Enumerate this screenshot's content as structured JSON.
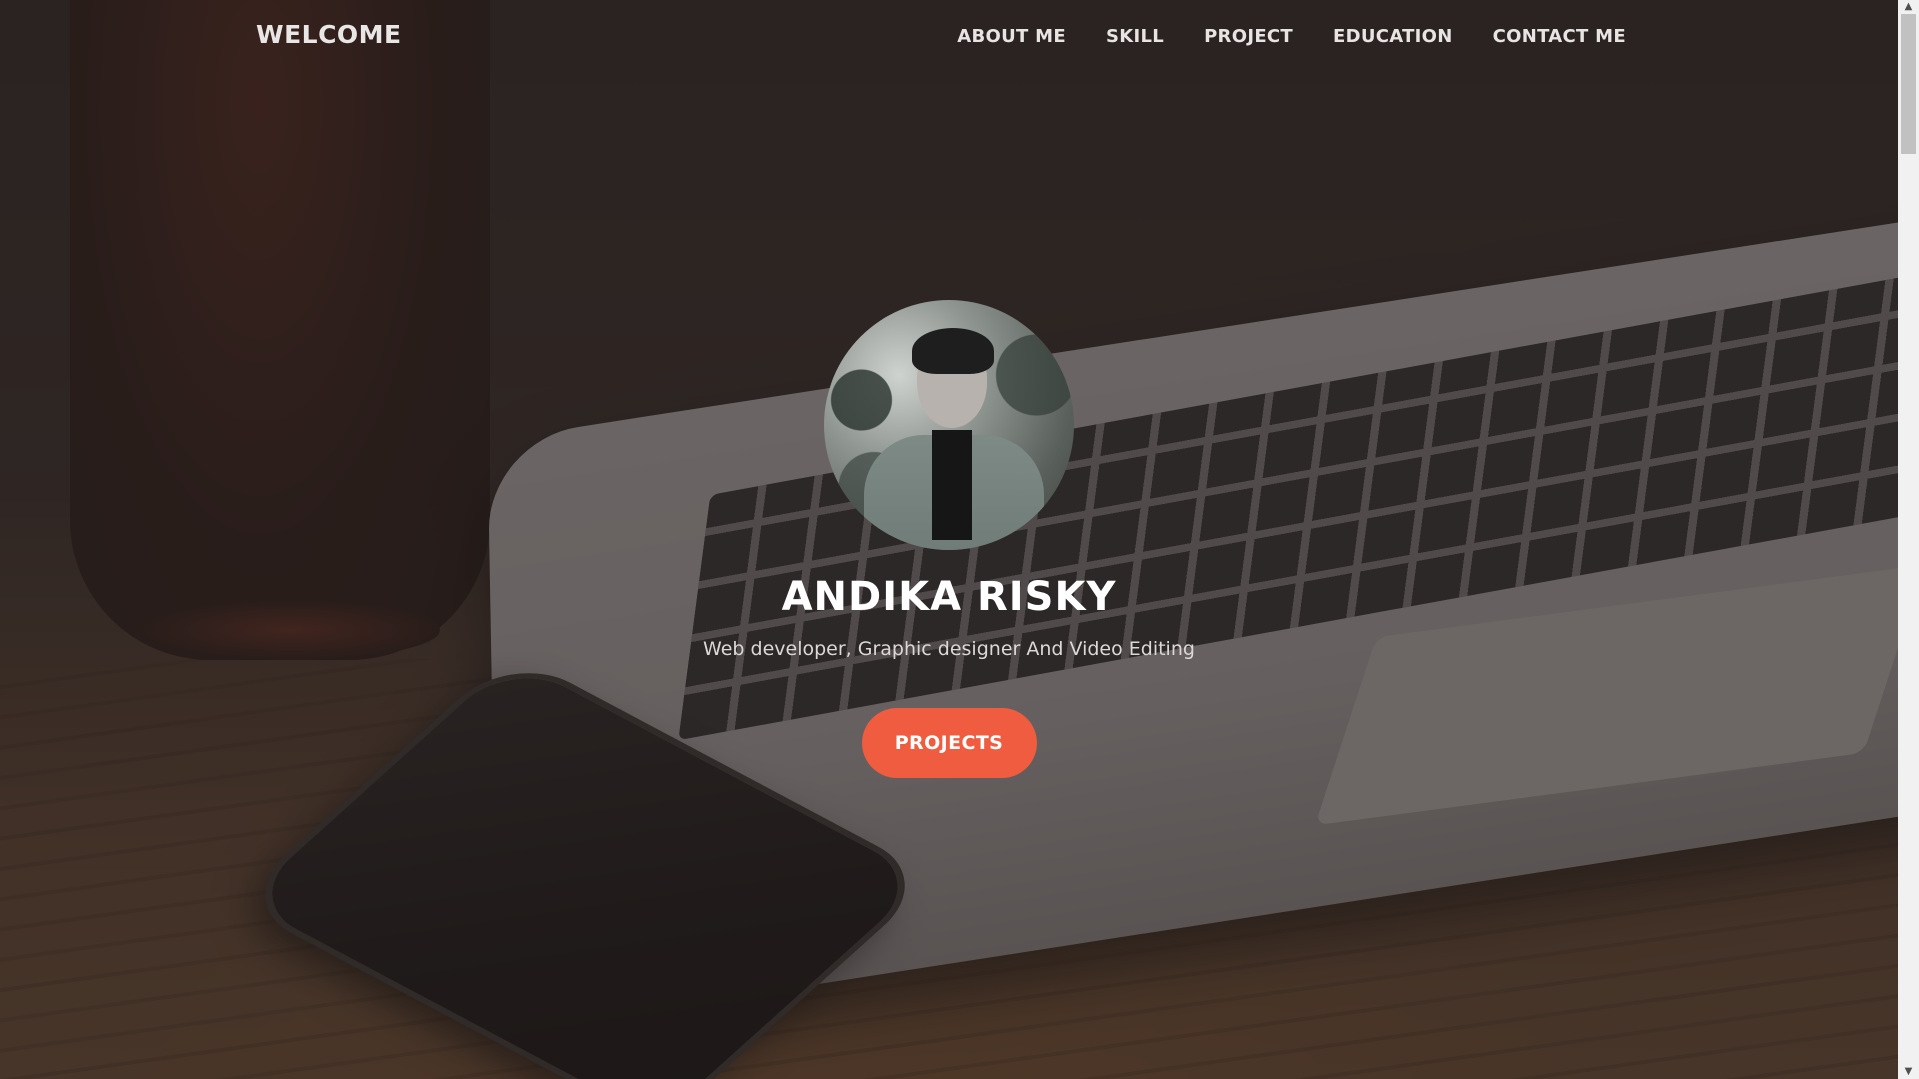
{
  "nav": {
    "brand": "WELCOME",
    "items": [
      {
        "label": "ABOUT ME"
      },
      {
        "label": "SKILL"
      },
      {
        "label": "PROJECT"
      },
      {
        "label": "EDUCATION"
      },
      {
        "label": "CONTACT ME"
      }
    ]
  },
  "hero": {
    "name": "ANDIKA RISKY",
    "tagline": "Web developer, Graphic designer And Video Editing",
    "button_label": "PROJECTS"
  },
  "colors": {
    "accent": "#ef5c3f",
    "overlay": "#2a2220"
  },
  "scrollbar": {
    "up_icon": "▲",
    "down_icon": "▼"
  }
}
